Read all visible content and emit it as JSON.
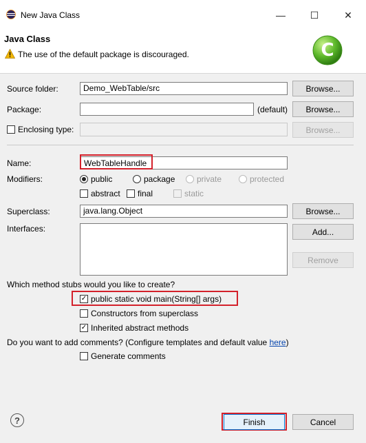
{
  "window": {
    "title": "New Java Class",
    "minimize_glyph": "—",
    "maximize_glyph": "☐",
    "close_glyph": "✕"
  },
  "header": {
    "title": "Java Class",
    "message": "The use of the default package is discouraged.",
    "logo_letter": "C"
  },
  "form": {
    "source_folder": {
      "label": "Source folder:",
      "value": "Demo_WebTable/src",
      "browse": "Browse..."
    },
    "package": {
      "label": "Package:",
      "value": "",
      "suffix": "(default)",
      "browse": "Browse..."
    },
    "enclosing": {
      "label": "Enclosing type:",
      "value": "",
      "browse": "Browse...",
      "checked": false
    },
    "name": {
      "label": "Name:",
      "value": "WebTableHandle"
    },
    "modifiers": {
      "label": "Modifiers:",
      "radios": [
        {
          "label": "public",
          "selected": true,
          "enabled": true
        },
        {
          "label": "package",
          "selected": false,
          "enabled": true
        },
        {
          "label": "private",
          "selected": false,
          "enabled": false
        },
        {
          "label": "protected",
          "selected": false,
          "enabled": false
        }
      ],
      "checks": [
        {
          "label": "abstract",
          "checked": false,
          "enabled": true
        },
        {
          "label": "final",
          "checked": false,
          "enabled": true
        },
        {
          "label": "static",
          "checked": false,
          "enabled": false
        }
      ]
    },
    "superclass": {
      "label": "Superclass:",
      "value": "java.lang.Object",
      "browse": "Browse..."
    },
    "interfaces": {
      "label": "Interfaces:",
      "add": "Add...",
      "remove": "Remove"
    },
    "stubs": {
      "question": "Which method stubs would you like to create?",
      "options": [
        {
          "label": "public static void main(String[] args)",
          "checked": true
        },
        {
          "label": "Constructors from superclass",
          "checked": false
        },
        {
          "label": "Inherited abstract methods",
          "checked": true
        }
      ]
    },
    "comments": {
      "question": "Do you want to add comments? (Configure templates and default value ",
      "link": "here",
      "question_end": ")",
      "option": {
        "label": "Generate comments",
        "checked": false
      }
    }
  },
  "footer": {
    "help_glyph": "?",
    "finish": "Finish",
    "cancel": "Cancel"
  },
  "colors": {
    "highlight": "#d3202a",
    "logo_green": "#5cb82a",
    "warning": "#f2b705"
  }
}
